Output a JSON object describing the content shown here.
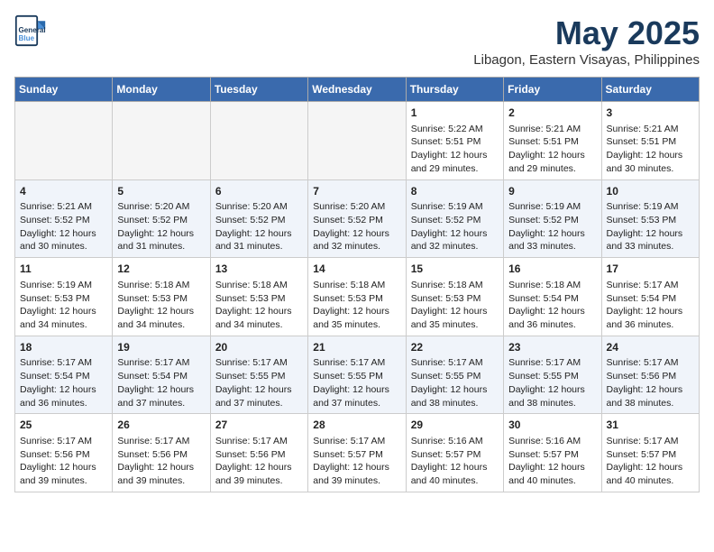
{
  "header": {
    "logo_line1": "General",
    "logo_line2": "Blue",
    "month_year": "May 2025",
    "location": "Libagon, Eastern Visayas, Philippines"
  },
  "weekdays": [
    "Sunday",
    "Monday",
    "Tuesday",
    "Wednesday",
    "Thursday",
    "Friday",
    "Saturday"
  ],
  "weeks": [
    [
      {
        "day": "",
        "info": ""
      },
      {
        "day": "",
        "info": ""
      },
      {
        "day": "",
        "info": ""
      },
      {
        "day": "",
        "info": ""
      },
      {
        "day": "1",
        "info": "Sunrise: 5:22 AM\nSunset: 5:51 PM\nDaylight: 12 hours\nand 29 minutes."
      },
      {
        "day": "2",
        "info": "Sunrise: 5:21 AM\nSunset: 5:51 PM\nDaylight: 12 hours\nand 29 minutes."
      },
      {
        "day": "3",
        "info": "Sunrise: 5:21 AM\nSunset: 5:51 PM\nDaylight: 12 hours\nand 30 minutes."
      }
    ],
    [
      {
        "day": "4",
        "info": "Sunrise: 5:21 AM\nSunset: 5:52 PM\nDaylight: 12 hours\nand 30 minutes."
      },
      {
        "day": "5",
        "info": "Sunrise: 5:20 AM\nSunset: 5:52 PM\nDaylight: 12 hours\nand 31 minutes."
      },
      {
        "day": "6",
        "info": "Sunrise: 5:20 AM\nSunset: 5:52 PM\nDaylight: 12 hours\nand 31 minutes."
      },
      {
        "day": "7",
        "info": "Sunrise: 5:20 AM\nSunset: 5:52 PM\nDaylight: 12 hours\nand 32 minutes."
      },
      {
        "day": "8",
        "info": "Sunrise: 5:19 AM\nSunset: 5:52 PM\nDaylight: 12 hours\nand 32 minutes."
      },
      {
        "day": "9",
        "info": "Sunrise: 5:19 AM\nSunset: 5:52 PM\nDaylight: 12 hours\nand 33 minutes."
      },
      {
        "day": "10",
        "info": "Sunrise: 5:19 AM\nSunset: 5:53 PM\nDaylight: 12 hours\nand 33 minutes."
      }
    ],
    [
      {
        "day": "11",
        "info": "Sunrise: 5:19 AM\nSunset: 5:53 PM\nDaylight: 12 hours\nand 34 minutes."
      },
      {
        "day": "12",
        "info": "Sunrise: 5:18 AM\nSunset: 5:53 PM\nDaylight: 12 hours\nand 34 minutes."
      },
      {
        "day": "13",
        "info": "Sunrise: 5:18 AM\nSunset: 5:53 PM\nDaylight: 12 hours\nand 34 minutes."
      },
      {
        "day": "14",
        "info": "Sunrise: 5:18 AM\nSunset: 5:53 PM\nDaylight: 12 hours\nand 35 minutes."
      },
      {
        "day": "15",
        "info": "Sunrise: 5:18 AM\nSunset: 5:53 PM\nDaylight: 12 hours\nand 35 minutes."
      },
      {
        "day": "16",
        "info": "Sunrise: 5:18 AM\nSunset: 5:54 PM\nDaylight: 12 hours\nand 36 minutes."
      },
      {
        "day": "17",
        "info": "Sunrise: 5:17 AM\nSunset: 5:54 PM\nDaylight: 12 hours\nand 36 minutes."
      }
    ],
    [
      {
        "day": "18",
        "info": "Sunrise: 5:17 AM\nSunset: 5:54 PM\nDaylight: 12 hours\nand 36 minutes."
      },
      {
        "day": "19",
        "info": "Sunrise: 5:17 AM\nSunset: 5:54 PM\nDaylight: 12 hours\nand 37 minutes."
      },
      {
        "day": "20",
        "info": "Sunrise: 5:17 AM\nSunset: 5:55 PM\nDaylight: 12 hours\nand 37 minutes."
      },
      {
        "day": "21",
        "info": "Sunrise: 5:17 AM\nSunset: 5:55 PM\nDaylight: 12 hours\nand 37 minutes."
      },
      {
        "day": "22",
        "info": "Sunrise: 5:17 AM\nSunset: 5:55 PM\nDaylight: 12 hours\nand 38 minutes."
      },
      {
        "day": "23",
        "info": "Sunrise: 5:17 AM\nSunset: 5:55 PM\nDaylight: 12 hours\nand 38 minutes."
      },
      {
        "day": "24",
        "info": "Sunrise: 5:17 AM\nSunset: 5:56 PM\nDaylight: 12 hours\nand 38 minutes."
      }
    ],
    [
      {
        "day": "25",
        "info": "Sunrise: 5:17 AM\nSunset: 5:56 PM\nDaylight: 12 hours\nand 39 minutes."
      },
      {
        "day": "26",
        "info": "Sunrise: 5:17 AM\nSunset: 5:56 PM\nDaylight: 12 hours\nand 39 minutes."
      },
      {
        "day": "27",
        "info": "Sunrise: 5:17 AM\nSunset: 5:56 PM\nDaylight: 12 hours\nand 39 minutes."
      },
      {
        "day": "28",
        "info": "Sunrise: 5:17 AM\nSunset: 5:57 PM\nDaylight: 12 hours\nand 39 minutes."
      },
      {
        "day": "29",
        "info": "Sunrise: 5:16 AM\nSunset: 5:57 PM\nDaylight: 12 hours\nand 40 minutes."
      },
      {
        "day": "30",
        "info": "Sunrise: 5:16 AM\nSunset: 5:57 PM\nDaylight: 12 hours\nand 40 minutes."
      },
      {
        "day": "31",
        "info": "Sunrise: 5:17 AM\nSunset: 5:57 PM\nDaylight: 12 hours\nand 40 minutes."
      }
    ]
  ],
  "colors": {
    "header_bg": "#3a6aad",
    "title_color": "#1a3a5c",
    "alt_row_bg": "#f0f4fa",
    "empty_bg": "#f5f5f5"
  }
}
